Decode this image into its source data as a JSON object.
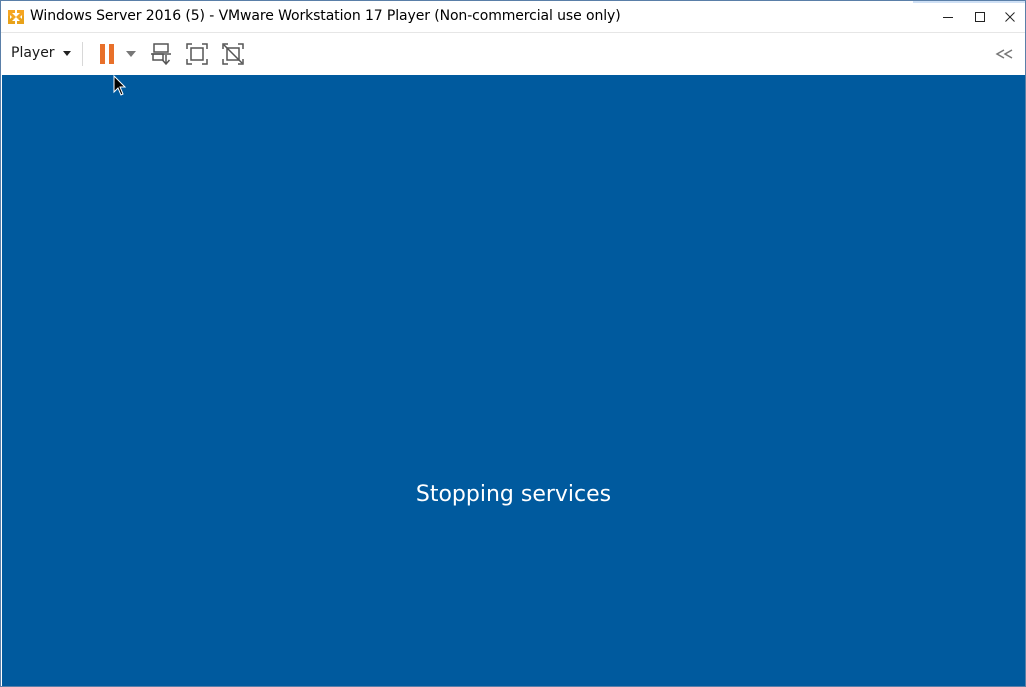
{
  "window": {
    "title": "Windows Server 2016 (5) - VMware Workstation 17 Player (Non-commercial use only)"
  },
  "toolbar": {
    "player_menu_label": "Player"
  },
  "vm": {
    "status_text": "Stopping services",
    "background_color": "#005a9e"
  },
  "icons": {
    "app": "vmware-player-icon",
    "pause": "pause-icon",
    "pause_dropdown": "chevron-down-icon",
    "send_cad": "ctrl-alt-del-icon",
    "fullscreen": "fullscreen-icon",
    "unity": "unity-icon",
    "collapse": "double-chevron-left-icon"
  },
  "colors": {
    "pause_accent": "#e8702a",
    "vm_blue": "#005a9e"
  }
}
